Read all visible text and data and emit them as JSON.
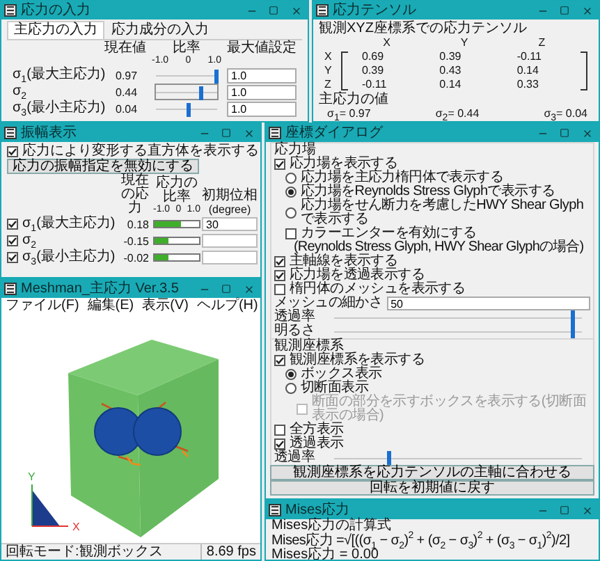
{
  "stress_input": {
    "title": "応力の入力",
    "tabs": [
      {
        "label": "主応力の入力",
        "selected": true
      },
      {
        "label": "応力成分の入力",
        "selected": false
      }
    ],
    "headers": [
      "現在値",
      "比率",
      "最大値設定"
    ],
    "ticks": [
      "-1.0",
      "0",
      "1.0"
    ],
    "rows": [
      {
        "label": "σ$_{1}$(最大主応力)",
        "value": "0.97",
        "level": 0.985,
        "max": "1.0",
        "focused": false
      },
      {
        "label": "σ$_{2}$",
        "value": "0.44",
        "level": 0.72,
        "max": "1.0",
        "focused": true
      },
      {
        "label": "σ$_{3}$(最小主応力)",
        "value": "0.04",
        "level": 0.52,
        "max": "1.0",
        "focused": false
      }
    ]
  },
  "stress_tensor": {
    "title": "応力テンソル",
    "heading": "観測XYZ座標系での応力テンソル",
    "columns": [
      "X",
      "Y",
      "Z"
    ],
    "rows": [
      {
        "label": "X",
        "values": [
          "0.69",
          "0.39",
          "-0.11"
        ]
      },
      {
        "label": "Y",
        "values": [
          "0.39",
          "0.43",
          "0.14"
        ]
      },
      {
        "label": "Z",
        "values": [
          "-0.11",
          "0.14",
          "0.33"
        ]
      }
    ],
    "principal_heading": "主応力の値",
    "principal": [
      "σ$_{1}$= 0.97",
      "σ$_{2}$= 0.44",
      "σ$_{3}$= 0.04"
    ]
  },
  "amplitude": {
    "title": "振幅表示",
    "deform": {
      "label": "応力により変形する直方体を表示する",
      "checked": true
    },
    "disable_button": "応力の振幅指定を無効にする",
    "columns": [
      {
        "label": "現在の応力"
      },
      {
        "label": "応力の比率"
      },
      {
        "label": "初期位相",
        "unit": "(degree)"
      }
    ],
    "ticks": [
      "-1.0",
      "0",
      "1.0"
    ],
    "rows": [
      {
        "label": "σ$_{1}$(最大主応力)",
        "checked": true,
        "value": "0.18",
        "level": 0.58,
        "phase": "30"
      },
      {
        "label": "σ$_{2}$",
        "checked": true,
        "value": "-0.15",
        "level": 0.31,
        "phase": ""
      },
      {
        "label": "σ$_{3}$(最小主応力)",
        "checked": true,
        "value": "-0.02",
        "level": 0.31,
        "phase": ""
      }
    ]
  },
  "coord_dialog": {
    "title": "座標ダイアログ",
    "groups": [
      {
        "label": "応力場",
        "items": [
          {
            "kind": "checkbox",
            "label": "応力場を表示する",
            "checked": true,
            "children": [
              {
                "kind": "radio",
                "label": "応力場を主応力楕円体で表示する",
                "selected": false
              },
              {
                "kind": "radio",
                "label": "応力場をReynolds Stress Glyphで表示する",
                "selected": true
              },
              {
                "kind": "radio",
                "label": "応力場をせん断力を考慮したHWY Shear Glyphで表示する",
                "selected": false
              },
              {
                "kind": "checkbox",
                "label": "カラーエンターを有効にする",
                "note": "(Reynolds Stress Glyph, HWY Shear Glyphの場合)",
                "checked": false
              }
            ]
          },
          {
            "kind": "checkbox",
            "label": "主軸線を表示する",
            "checked": true
          },
          {
            "kind": "checkbox",
            "label": "応力場を透過表示する",
            "checked": true
          },
          {
            "kind": "checkbox",
            "label": "楕円体のメッシュを表示する",
            "checked": false
          },
          {
            "kind": "field",
            "label": "メッシュの細かさ",
            "value": "50"
          },
          {
            "kind": "slider",
            "label": "透過率",
            "level": 0.96
          },
          {
            "kind": "slider",
            "label": "明るさ",
            "level": 0.96
          }
        ]
      },
      {
        "label": "観測座標系",
        "items": [
          {
            "kind": "checkbox",
            "label": "観測座標系を表示する",
            "checked": true,
            "children": [
              {
                "kind": "radio",
                "label": "ボックス表示",
                "selected": true
              },
              {
                "kind": "radio",
                "label": "切断面表示",
                "selected": false,
                "children": [
                  {
                    "kind": "checkbox",
                    "label": "断面の部分を示すボックスを表示する(切断面表示の場合)",
                    "checked": false,
                    "disabled": true
                  }
                ]
              }
            ]
          },
          {
            "kind": "checkbox",
            "label": "全方表示",
            "checked": false
          },
          {
            "kind": "checkbox",
            "label": "透過表示",
            "checked": true
          },
          {
            "kind": "slider",
            "label": "透過率",
            "level": 0.22
          }
        ]
      }
    ],
    "buttons": [
      "観測座標系を応力テンソルの主軸に合わせる",
      "回転を初期値に戻す"
    ]
  },
  "viewer": {
    "title": "Meshman_主応力 Ver.3.5",
    "menu": [
      "ファイル(F)",
      "編集(E)",
      "表示(V)",
      "ヘルプ(H)"
    ],
    "axes": [
      "Y",
      "X"
    ],
    "status": [
      "回転モード:観測ボックス",
      "8.69 fps"
    ]
  },
  "mises": {
    "title": "Mises応力",
    "formula_label": "Mises応力の計算式",
    "formula": "Mises応力 =√[((σ$_{1}$ − σ$_{2}$)$^{2}$ + (σ$_{2}$ − σ$_{3}$)$^{2}$ + (σ$_{3}$ − σ$_{1}$)$^{2}$)/2]",
    "result": "Mises応力 = 0.00"
  }
}
